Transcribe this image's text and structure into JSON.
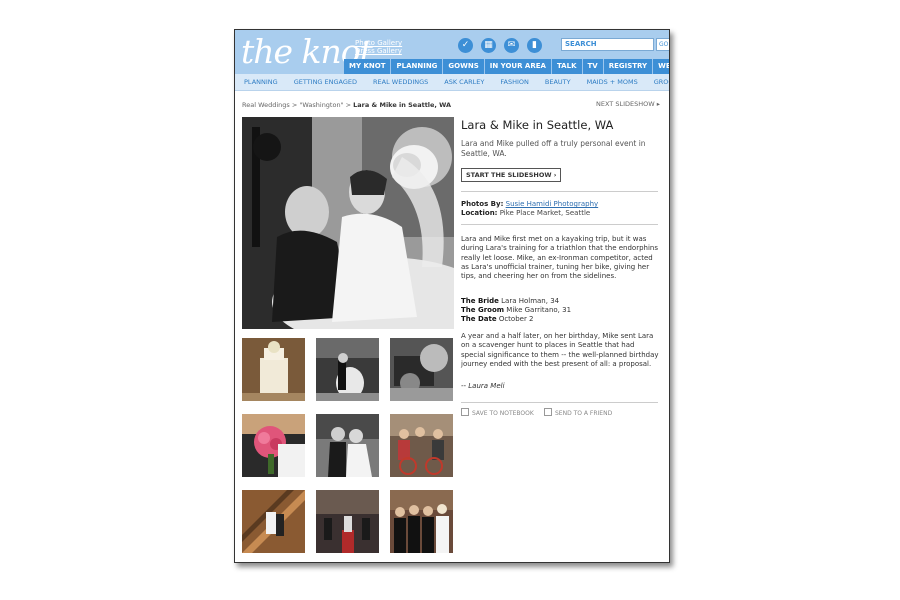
{
  "header": {
    "logo": "the knot",
    "links": [
      "Photo Gallery",
      "Dress Gallery"
    ],
    "icons": [
      "checkmark-icon",
      "calendar-icon",
      "envelope-icon",
      "notebook-icon"
    ],
    "search_placeholder": "SEARCH",
    "go_label": "GO"
  },
  "nav": {
    "main": [
      "MY KNOT",
      "PLANNING",
      "GOWNS",
      "IN YOUR AREA",
      "TALK",
      "TV",
      "REGISTRY",
      "WEDDING"
    ],
    "sub": [
      "PLANNING",
      "GETTING ENGAGED",
      "REAL WEDDINGS",
      "ASK CARLEY",
      "FASHION",
      "BEAUTY",
      "MAIDS + MOMS",
      "GROO"
    ]
  },
  "breadcrumb": {
    "path": "Real Weddings > \"Washington\" > ",
    "current": "Lara & Mike in Seattle, WA"
  },
  "next_slideshow": "NEXT SLIDESHOW ▸",
  "article": {
    "title": "Lara & Mike in Seattle, WA",
    "intro": "Lara and Mike pulled off a truly personal event in Seattle, WA.",
    "start_button": "START THE SLIDESHOW ›",
    "photos_by_label": "Photos By:",
    "photographer": "Susie Hamidi Photography",
    "location_label": "Location:",
    "location": "Pike Place Market, Seattle",
    "story_1": "Lara and Mike first met on a kayaking trip, but it was during Lara's training for a triathlon that the endorphins really let loose. Mike, an ex-Ironman competitor, acted as Lara's unofficial trainer, tuning her bike, giving her tips, and cheering her on from the sidelines.",
    "bride_label": "The Bride",
    "bride": "Lara Holman, 34",
    "groom_label": "The Groom",
    "groom": "Mike Garritano, 31",
    "date_label": "The Date",
    "date": "October 2",
    "story_2": "A year and a half later, on her birthday, Mike sent Lara on a scavenger hunt to places in Seattle that had special significance to them -- the well-planned birthday journey ended with the best present of all: a proposal.",
    "signature": "-- Laura Meli",
    "save_label": "SAVE TO NOTEBOOK",
    "send_label": "SEND TO A FRIEND"
  },
  "colors": {
    "header_bg": "#a9cdee",
    "nav_bg": "#3d8fd6",
    "subnav_bg": "#d9e9f8",
    "link": "#2f6fb0"
  }
}
